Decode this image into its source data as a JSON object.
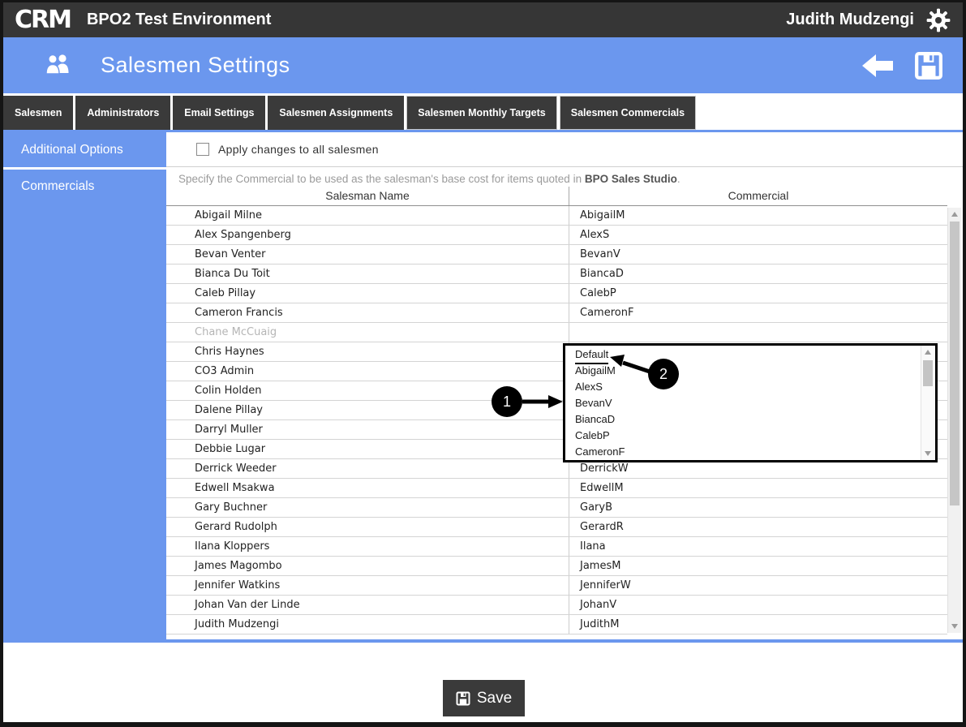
{
  "topbar": {
    "logo": "CRM",
    "app_title": "BPO2 Test Environment",
    "user_name": "Judith Mudzengi"
  },
  "page_header": {
    "title": "Salesmen Settings"
  },
  "tabs": [
    {
      "label": "Salesmen",
      "outlined": false
    },
    {
      "label": "Administrators",
      "outlined": false
    },
    {
      "label": "Email Settings",
      "outlined": false
    },
    {
      "label": "Salesmen Assignments",
      "outlined": false
    },
    {
      "label": "Salesmen Monthly Targets",
      "outlined": true
    },
    {
      "label": "Salesmen Commercials",
      "outlined": true
    }
  ],
  "sidebar": {
    "items": [
      {
        "label": "Additional Options"
      },
      {
        "label": "Commercials"
      }
    ]
  },
  "options_bar": {
    "checkbox_label": "Apply changes to all salesmen",
    "checked": false
  },
  "description": {
    "text_before": "Specify the Commercial to be used as the salesman's base cost for items quoted in ",
    "text_bold": "BPO Sales Studio",
    "text_after": "."
  },
  "table": {
    "columns": [
      "Salesman Name",
      "Commercial"
    ],
    "rows": [
      {
        "name": "Abigail Milne",
        "commercial": "AbigailM",
        "disabled": false
      },
      {
        "name": "Alex Spangenberg",
        "commercial": "AlexS",
        "disabled": false
      },
      {
        "name": "Bevan Venter",
        "commercial": "BevanV",
        "disabled": false
      },
      {
        "name": "Bianca Du Toit",
        "commercial": "BiancaD",
        "disabled": false
      },
      {
        "name": "Caleb Pillay",
        "commercial": "CalebP",
        "disabled": false
      },
      {
        "name": "Cameron Francis",
        "commercial": "CameronF",
        "disabled": false
      },
      {
        "name": "Chane McCuaig",
        "commercial": "",
        "disabled": true
      },
      {
        "name": "Chris Haynes",
        "commercial": "",
        "disabled": false
      },
      {
        "name": "CO3 Admin",
        "commercial": "",
        "disabled": false
      },
      {
        "name": "Colin Holden",
        "commercial": "",
        "disabled": false
      },
      {
        "name": "Dalene Pillay",
        "commercial": "",
        "disabled": false
      },
      {
        "name": "Darryl Muller",
        "commercial": "",
        "disabled": false
      },
      {
        "name": "Debbie Lugar",
        "commercial": "",
        "disabled": false
      },
      {
        "name": "Derrick Weeder",
        "commercial": "DerrickW",
        "disabled": false
      },
      {
        "name": "Edwell Msakwa",
        "commercial": "EdwellM",
        "disabled": false
      },
      {
        "name": "Gary Buchner",
        "commercial": "GaryB",
        "disabled": false
      },
      {
        "name": "Gerard Rudolph",
        "commercial": "GerardR",
        "disabled": false
      },
      {
        "name": "Ilana Kloppers",
        "commercial": "Ilana",
        "disabled": false
      },
      {
        "name": "James Magombo",
        "commercial": "JamesM",
        "disabled": false
      },
      {
        "name": "Jennifer Watkins",
        "commercial": "JenniferW",
        "disabled": false
      },
      {
        "name": "Johan Van der Linde",
        "commercial": "JohanV",
        "disabled": false
      },
      {
        "name": "Judith Mudzengi",
        "commercial": "JudithM",
        "disabled": false
      }
    ]
  },
  "dropdown": {
    "items": [
      "Default",
      "AbigailM",
      "AlexS",
      "BevanV",
      "BiancaD",
      "CalebP",
      "CameronF"
    ],
    "highlighted_item": "Default"
  },
  "callouts": [
    {
      "number": "1"
    },
    {
      "number": "2"
    }
  ],
  "footer": {
    "save_label": "Save"
  },
  "colors": {
    "accent_blue": "#6b97ee",
    "dark_bar": "#363636",
    "disabled_text": "#b5b5b5"
  }
}
